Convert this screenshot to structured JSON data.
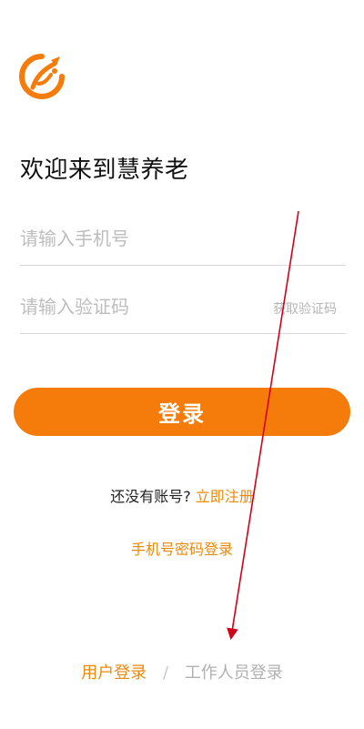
{
  "logo": {
    "icon": "brand-logo-icon",
    "color": "#f57c0a"
  },
  "welcome": {
    "title": "欢迎来到慧养老"
  },
  "phone": {
    "placeholder": "请输入手机号",
    "value": ""
  },
  "code": {
    "placeholder": "请输入验证码",
    "value": "",
    "get_code_label": "获取验证码"
  },
  "login": {
    "label": "登录",
    "color": "#f57c0a"
  },
  "register": {
    "question": "还没有账号?",
    "link": "立即注册"
  },
  "password_login": {
    "label": "手机号密码登录"
  },
  "mode": {
    "user": "用户登录",
    "separator": "/",
    "staff": "工作人员登录"
  },
  "colors": {
    "accent": "#e88a0c",
    "annotation_arrow": "#d0021b"
  }
}
